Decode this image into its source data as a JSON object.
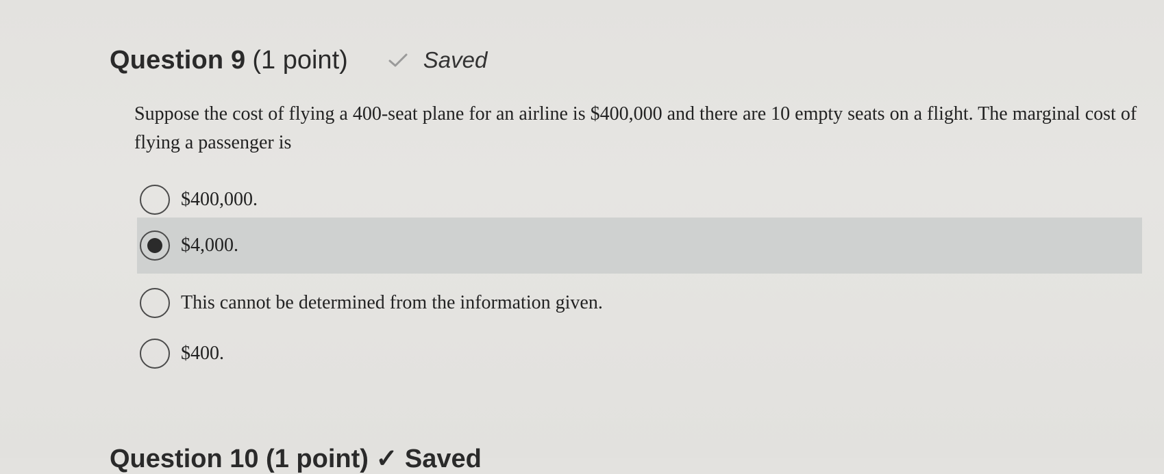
{
  "question": {
    "title": "Question 9",
    "points": "(1 point)",
    "saved_label": "Saved",
    "text": "Suppose the cost of flying a 400-seat plane for an airline is $400,000 and there are 10 empty seats on a flight. The marginal cost of flying a passenger is"
  },
  "choices": [
    {
      "label": "$400,000.",
      "selected": false
    },
    {
      "label": "$4,000.",
      "selected": true
    },
    {
      "label": "This cannot be determined from the information given.",
      "selected": false
    },
    {
      "label": "$400.",
      "selected": false
    }
  ],
  "next_question": {
    "title": "Question 10 (1 point)  ✓ Saved"
  },
  "colors": {
    "background": "#e4e3e0",
    "selected_band": "#cfd1d0",
    "text": "#222222",
    "radio_border": "#4a4a4a"
  },
  "icons": {
    "saved": "check-icon",
    "radio": "radio-button"
  }
}
